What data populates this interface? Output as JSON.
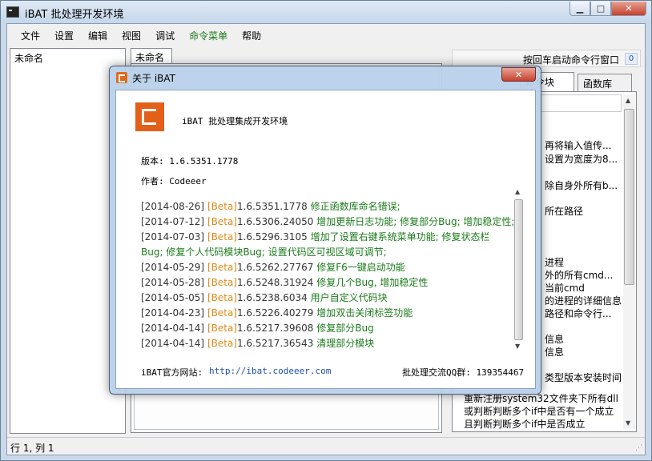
{
  "window": {
    "title": "iBAT 批处理开发环境"
  },
  "menu": [
    "文件",
    "设置",
    "编辑",
    "视图",
    "调试",
    "命令菜单",
    "帮助"
  ],
  "left_panel": {
    "item": "未命名"
  },
  "editor": {
    "tab": "未命名"
  },
  "right": {
    "cmd_label": "按回车启动命令行窗口",
    "cmd_count": "0",
    "tabs": [
      "命令块",
      "函数库"
    ],
    "lines": [
      "再将输入值传...",
      "设置为宽度为8...",
      "除自身外所有b...",
      "所在路径",
      "进程",
      "外的所有cmd...",
      "当前cmd",
      "的进程的详细信息",
      "路径和命令行...",
      "信息",
      "信息",
      "类型版本安装时间",
      "重新注册system32文件夹下所有dll",
      "或判断判断多个if中是否有一个成立",
      "且判断判断多个if中是否成立"
    ]
  },
  "status": {
    "position": "行 1, 列 1"
  },
  "dialog": {
    "title": "关于 iBAT",
    "app_name": "iBAT 批处理集成开发环境",
    "version_label": "版本: 1.6.5351.1778",
    "author_label": "作者: Codeeer",
    "changelog": [
      {
        "date": "[2014-08-26]",
        "tag": "[Beta]",
        "ver": "1.6.5351.1778",
        "desc": "修正函数库命名错误;"
      },
      {
        "date": "[2014-07-12]",
        "tag": "[Beta]",
        "ver": "1.6.5306.24050",
        "desc": "增加更新日志功能; 修复部分Bug; 增加稳定性;"
      },
      {
        "date": "[2014-07-03]",
        "tag": "[Beta]",
        "ver": "1.6.5296.3105",
        "desc": "增加了设置右键系统菜单功能; 修复状态栏Bug; 修复个人代码模块Bug; 设置代码区可视区域可调节;"
      },
      {
        "date": "[2014-05-29]",
        "tag": "[Beta]",
        "ver": "1.6.5262.27767",
        "desc": "修复F6一键启动功能"
      },
      {
        "date": "[2014-05-28]",
        "tag": "[Beta]",
        "ver": "1.6.5248.31924",
        "desc": "修复几个Bug, 增加稳定性"
      },
      {
        "date": "[2014-05-05]",
        "tag": "[Beta]",
        "ver": "1.6.5238.6034",
        "desc": "用户自定义代码块"
      },
      {
        "date": "[2014-04-23]",
        "tag": "[Beta]",
        "ver": "1.6.5226.40279",
        "desc": "增加双击关闭标签功能"
      },
      {
        "date": "[2014-04-14]",
        "tag": "[Beta]",
        "ver": "1.6.5217.39608",
        "desc": "修复部分Bug"
      },
      {
        "date": "[2014-04-14]",
        "tag": "[Beta]",
        "ver": "1.6.5217.36543",
        "desc": "清理部分模块"
      }
    ],
    "website_label": "iBAT官方网站:",
    "website_url": "http://ibat.codeeer.com",
    "qq_label": "批处理交流QQ群: 139354467"
  },
  "colors": {
    "beta": "#e08a1a",
    "green_text": "#1a7a1a",
    "link": "#1f4fa8",
    "logo": "#e2601a"
  }
}
